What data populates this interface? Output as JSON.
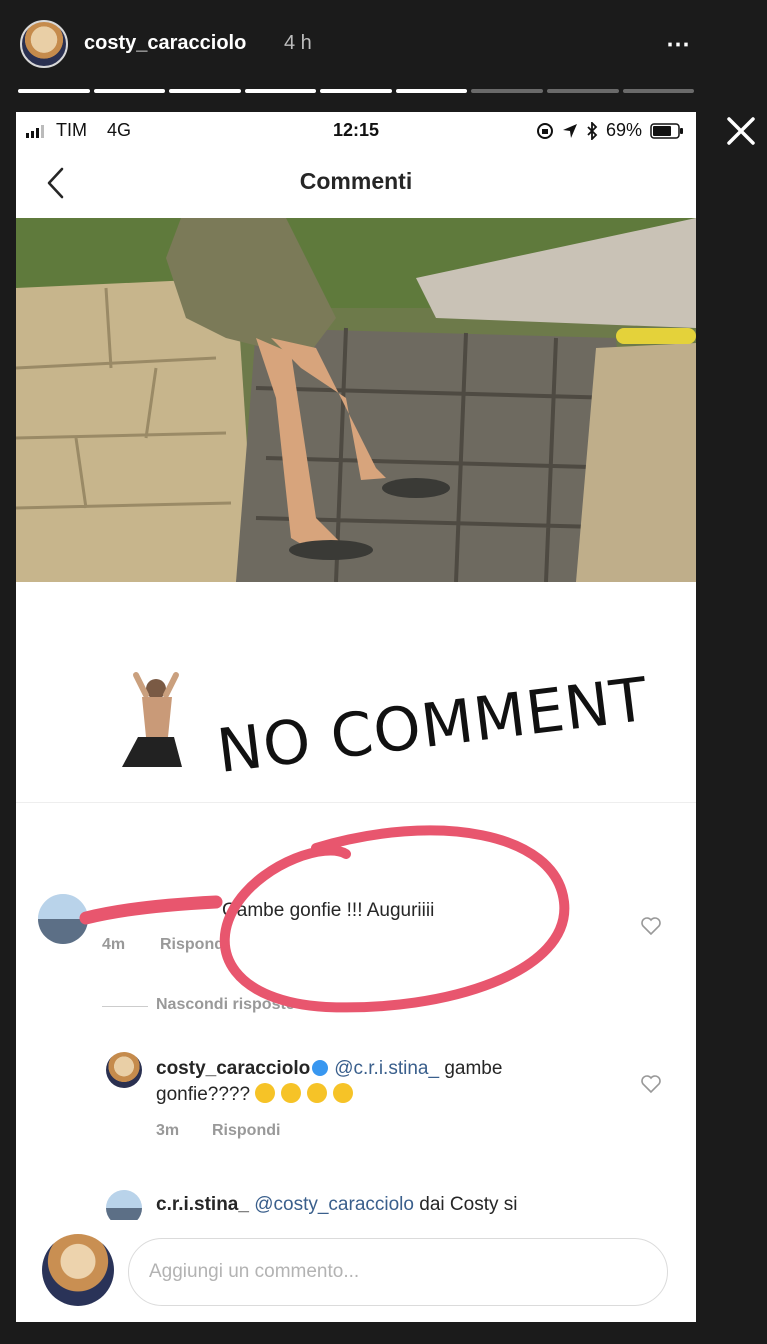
{
  "story": {
    "username": "costy_caracciolo",
    "time": "4 h",
    "more_icon": "⋯",
    "progress_segments": {
      "total": 9,
      "completed": 6
    }
  },
  "status_bar": {
    "carrier": "TIM",
    "network": "4G",
    "time": "12:15",
    "battery": "69%"
  },
  "nav": {
    "title": "Commenti"
  },
  "overlay": {
    "text": "NO COMMENT"
  },
  "comments": [
    {
      "text": "Gambe gonfie !!! Auguriiii",
      "time": "4m",
      "reply": "Rispondi"
    }
  ],
  "hide_replies": "Nascondi risposte",
  "reply1": {
    "username": "costy_caracciolo",
    "mention": "@c.r.i.stina_",
    "text": "gambe gonfie????",
    "time": "3m",
    "reply": "Rispondi"
  },
  "reply2": {
    "username": "c.r.i.stina_",
    "mention": "@costy_caracciolo",
    "text": "dai Costy si"
  },
  "composer": {
    "placeholder": "Aggiungi un commento..."
  },
  "colors": {
    "mention": "#3a5f8c",
    "annotation": "#e8566e",
    "verified": "#3897f0"
  }
}
